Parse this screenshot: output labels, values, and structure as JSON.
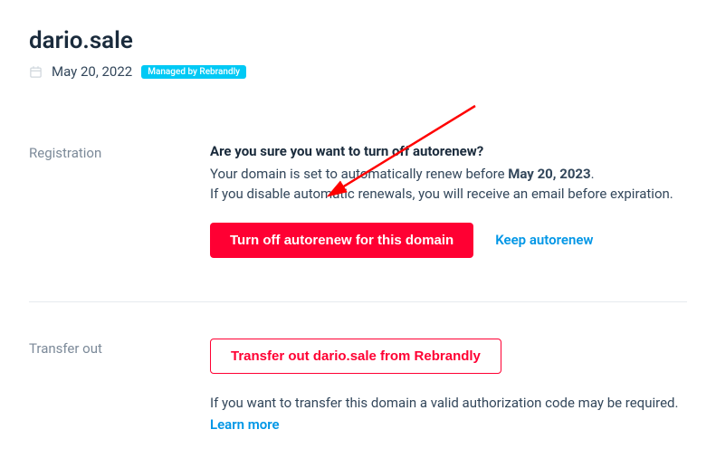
{
  "header": {
    "domain": "dario.sale",
    "date": "May 20, 2022",
    "badge": "Managed by Rebrandly"
  },
  "registration": {
    "label": "Registration",
    "confirm_heading": "Are you sure you want to turn off autorenew?",
    "line1_prefix": "Your domain is set to automatically renew before ",
    "line1_date": "May 20, 2023",
    "line1_suffix": ".",
    "line2": "If you disable automatic renewals, you will receive an email before expiration.",
    "turn_off_label": "Turn off autorenew for this domain",
    "keep_label": "Keep autorenew"
  },
  "transfer": {
    "label": "Transfer out",
    "button_label": "Transfer out dario.sale from Rebrandly",
    "info": "If you want to transfer this domain a valid authorization code may be required.",
    "learn_more": "Learn more"
  }
}
